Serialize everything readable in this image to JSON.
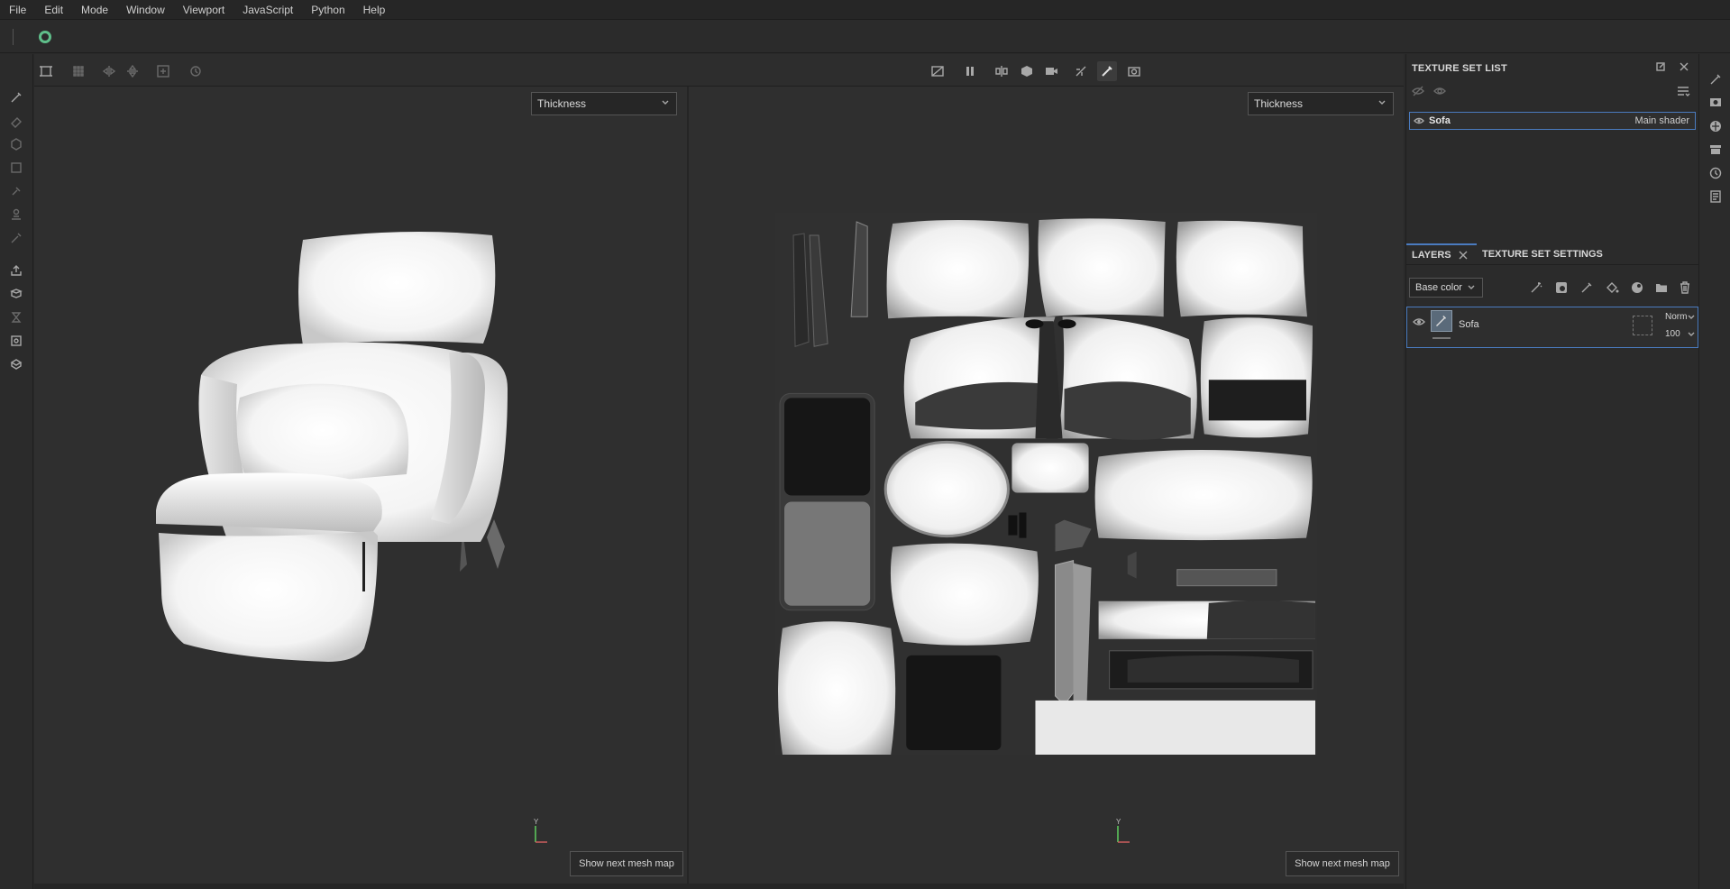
{
  "menu": [
    "File",
    "Edit",
    "Mode",
    "Window",
    "Viewport",
    "JavaScript",
    "Python",
    "Help"
  ],
  "viewports": {
    "left": {
      "channel": "Thickness",
      "button": "Show next mesh map",
      "axis": "Y"
    },
    "right": {
      "channel": "Thickness",
      "button": "Show next mesh map",
      "axis": "Y"
    }
  },
  "texture_set_list": {
    "title": "TEXTURE SET LIST",
    "items": [
      {
        "name": "Sofa",
        "shader": "Main shader"
      }
    ]
  },
  "layers": {
    "tab_layers": "LAYERS",
    "tab_settings": "TEXTURE SET SETTINGS",
    "channel": "Base color",
    "items": [
      {
        "name": "Sofa",
        "blend": "Norm",
        "opacity": "100"
      }
    ]
  },
  "colors": {
    "accent": "#4a7bbf",
    "logo": "#5fbf8a"
  }
}
